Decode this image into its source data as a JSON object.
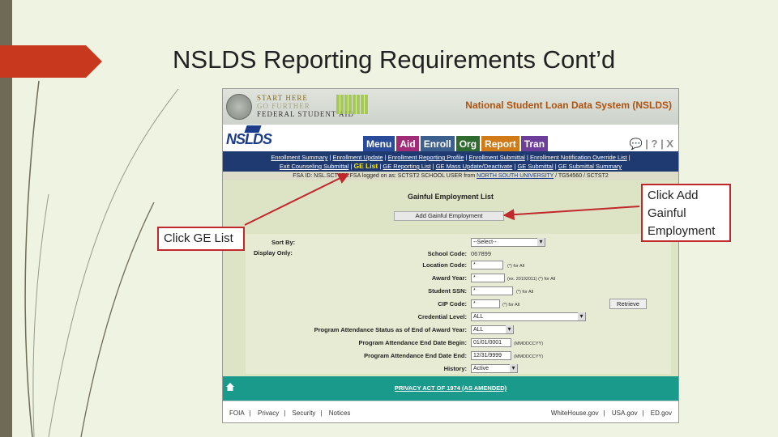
{
  "slide": {
    "title": "NSLDS Reporting Requirements Cont’d"
  },
  "banner": {
    "fsa_line1": "START HERE",
    "fsa_line2": "GO FURTHER",
    "fsa_line3": "FEDERAL STUDENT AID",
    "system_title": "National Student Loan Data System (NSLDS)"
  },
  "nav": {
    "logo": "NSLDS",
    "tabs": [
      "Menu",
      "Aid",
      "Enroll",
      "Org",
      "Report",
      "Tran"
    ],
    "tool_icons": "💬 | ? | X"
  },
  "subnav": {
    "row1": [
      "Enrollment Summary",
      "Enrollment Update",
      "Enrollment Reporting Profile",
      "Enrollment Submittal",
      "Enrollment Notification Override List"
    ],
    "row2": [
      "Exit Counseling Submittal",
      "GE List",
      "GE Reporting List",
      "GE Mass Update/Deactivate",
      "GE Submittal",
      "GE Submittal Summary"
    ]
  },
  "logon": {
    "prefix": "FSA ID: NSL.SCTST2.FSA logged on as: SCTST2 SCHOOL USER from",
    "school": "NORTH SOUTH UNIVERSITY",
    "suffix": "/ TG54560 / SCTST2"
  },
  "page": {
    "title": "Gainful Employment List",
    "add_button": "Add Gainful Employment",
    "retrieve_button": "Retrieve"
  },
  "form": {
    "sort_by_label": "Sort By:",
    "sort_by_value": "--Select--",
    "display_only_label": "Display Only:",
    "school_code_label": "School Code:",
    "school_code_value": "067899",
    "location_code_label": "Location Code:",
    "location_code_value": "*",
    "location_code_hint": "(*) for All",
    "award_year_label": "Award Year:",
    "award_year_value": "*",
    "award_year_hint": "(ex. 20192011) (*) for All",
    "student_ssn_label": "Student SSN:",
    "student_ssn_value": "*",
    "student_ssn_hint": "(*) for All",
    "cip_code_label": "CIP Code:",
    "cip_code_value": "*",
    "cip_code_hint": "(*) for All",
    "credential_level_label": "Credential Level:",
    "credential_level_value": "ALL",
    "program_status_label": "Program Attendance Status as of End of Award Year:",
    "program_status_value": "ALL",
    "end_date_begin_label": "Program Attendance End Date Begin:",
    "end_date_begin_value": "01/01/0001",
    "end_date_begin_hint": "(MMDDCCYY)",
    "end_date_end_label": "Program Attendance End Date End:",
    "end_date_end_value": "12/31/9999",
    "end_date_end_hint": "(MMDDCCYY)",
    "history_label": "History:",
    "history_value": "Active"
  },
  "privacy": {
    "link": "PRIVACY ACT OF 1974 (AS AMENDED)"
  },
  "footer": {
    "left": [
      "FOIA",
      "Privacy",
      "Security",
      "Notices"
    ],
    "right": [
      "WhiteHouse.gov",
      "USA.gov",
      "ED.gov"
    ]
  },
  "callouts": {
    "ge_list": "Click GE List",
    "add_ge_line1": "Click Add",
    "add_ge_line2": "Gainful",
    "add_ge_line3": "Employment"
  },
  "colors": {
    "callout_border": "#c0282c",
    "nav_bar": "#1f3a70",
    "privacy_bar": "#1a9a8a"
  }
}
